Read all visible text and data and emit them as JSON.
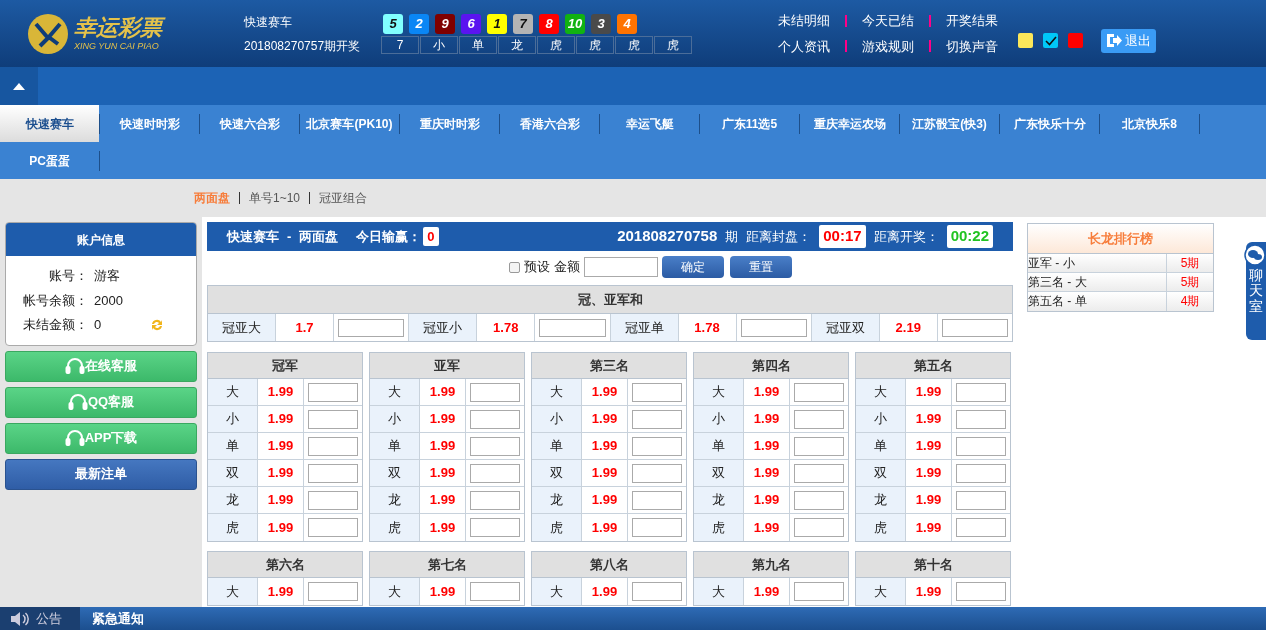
{
  "header": {
    "logo_title": "幸运彩票",
    "logo_subtitle": "XING YUN CAI PIAO",
    "game": "快速赛车",
    "draw_label": "201808270757期开奖",
    "balls": [
      {
        "number": "5",
        "color": "#81ffff"
      },
      {
        "number": "2",
        "color": "#0a86f5"
      },
      {
        "number": "9",
        "color": "#7f0000"
      },
      {
        "number": "6",
        "color": "#5a14f0"
      },
      {
        "number": "1",
        "color": "#ffff00"
      },
      {
        "number": "7",
        "color": "#b4b4b4"
      },
      {
        "number": "8",
        "color": "#ff0000"
      },
      {
        "number": "10",
        "color": "#11b211"
      },
      {
        "number": "3",
        "color": "#4a4a4a"
      },
      {
        "number": "4",
        "color": "#ff7300"
      }
    ],
    "results": [
      "7",
      "小",
      "单",
      "龙",
      "虎",
      "虎",
      "虎",
      "虎"
    ],
    "links": [
      "未结明细",
      "今天已结",
      "开奖结果",
      "个人资讯",
      "游戏规则",
      "切换声音"
    ],
    "swatches": [
      {
        "color": "#fbe75a",
        "selected": false
      },
      {
        "color": "#00c8f8",
        "selected": true
      },
      {
        "color": "#ff0000",
        "selected": false
      }
    ],
    "logout": "退出"
  },
  "nav": [
    {
      "label": "快速赛车",
      "selected": true
    },
    {
      "label": "快速时时彩",
      "selected": false
    },
    {
      "label": "快速六合彩",
      "selected": false
    },
    {
      "label": "北京赛车(PK10)",
      "selected": false
    },
    {
      "label": "重庆时时彩",
      "selected": false
    },
    {
      "label": "香港六合彩",
      "selected": false
    },
    {
      "label": "幸运飞艇",
      "selected": false
    },
    {
      "label": "广东11选5",
      "selected": false
    },
    {
      "label": "重庆幸运农场",
      "selected": false
    },
    {
      "label": "江苏骰宝(快3)",
      "selected": false
    },
    {
      "label": "广东快乐十分",
      "selected": false
    },
    {
      "label": "北京快乐8",
      "selected": false
    },
    {
      "label": "PC蛋蛋",
      "selected": false
    }
  ],
  "subnav": [
    {
      "label": "两面盘",
      "selected": true
    },
    {
      "label": "单号1~10",
      "selected": false
    },
    {
      "label": "冠亚组合",
      "selected": false
    }
  ],
  "account": {
    "title": "账户信息",
    "rows": [
      {
        "label": "账号：",
        "value": "游客"
      },
      {
        "label": "帐号余额：",
        "value": "2000"
      },
      {
        "label": "未结金额：",
        "value": "0"
      }
    ]
  },
  "side_buttons": [
    {
      "label": "在线客服",
      "kind": "support"
    },
    {
      "label": "QQ客服",
      "kind": "support"
    },
    {
      "label": "APP下载",
      "kind": "support"
    },
    {
      "label": "最新注单",
      "kind": "plain"
    }
  ],
  "bet_header": {
    "game": "快速赛车",
    "separator": "-",
    "mode": "两面盘",
    "pl_label": "今日输赢：",
    "pl_value": "0",
    "period": "201808270758",
    "period_unit": "期",
    "close_label": "距离封盘：",
    "close_time": "00:17",
    "draw_label": "距离开奖：",
    "draw_time": "00:22"
  },
  "preset": {
    "label": "预设",
    "checked": false,
    "amount_label": "金额",
    "confirm": "确定",
    "reset": "重置"
  },
  "sum_group": {
    "title": "冠、亚军和",
    "cells": [
      {
        "name": "冠亚大",
        "odds": "1.7"
      },
      {
        "name": "冠亚小",
        "odds": "1.78"
      },
      {
        "name": "冠亚单",
        "odds": "1.78"
      },
      {
        "name": "冠亚双",
        "odds": "2.19"
      }
    ]
  },
  "groups": [
    {
      "title": "冠军",
      "rows": [
        {
          "name": "大",
          "odds": "1.99"
        },
        {
          "name": "小",
          "odds": "1.99"
        },
        {
          "name": "单",
          "odds": "1.99"
        },
        {
          "name": "双",
          "odds": "1.99"
        },
        {
          "name": "龙",
          "odds": "1.99"
        },
        {
          "name": "虎",
          "odds": "1.99"
        }
      ]
    },
    {
      "title": "亚军",
      "rows": [
        {
          "name": "大",
          "odds": "1.99"
        },
        {
          "name": "小",
          "odds": "1.99"
        },
        {
          "name": "单",
          "odds": "1.99"
        },
        {
          "name": "双",
          "odds": "1.99"
        },
        {
          "name": "龙",
          "odds": "1.99"
        },
        {
          "name": "虎",
          "odds": "1.99"
        }
      ]
    },
    {
      "title": "第三名",
      "rows": [
        {
          "name": "大",
          "odds": "1.99"
        },
        {
          "name": "小",
          "odds": "1.99"
        },
        {
          "name": "单",
          "odds": "1.99"
        },
        {
          "name": "双",
          "odds": "1.99"
        },
        {
          "name": "龙",
          "odds": "1.99"
        },
        {
          "name": "虎",
          "odds": "1.99"
        }
      ]
    },
    {
      "title": "第四名",
      "rows": [
        {
          "name": "大",
          "odds": "1.99"
        },
        {
          "name": "小",
          "odds": "1.99"
        },
        {
          "name": "单",
          "odds": "1.99"
        },
        {
          "name": "双",
          "odds": "1.99"
        },
        {
          "name": "龙",
          "odds": "1.99"
        },
        {
          "name": "虎",
          "odds": "1.99"
        }
      ]
    },
    {
      "title": "第五名",
      "rows": [
        {
          "name": "大",
          "odds": "1.99"
        },
        {
          "name": "小",
          "odds": "1.99"
        },
        {
          "name": "单",
          "odds": "1.99"
        },
        {
          "name": "双",
          "odds": "1.99"
        },
        {
          "name": "龙",
          "odds": "1.99"
        },
        {
          "name": "虎",
          "odds": "1.99"
        }
      ]
    },
    {
      "title": "第六名",
      "rows": [
        {
          "name": "大",
          "odds": "1.99"
        }
      ]
    },
    {
      "title": "第七名",
      "rows": [
        {
          "name": "大",
          "odds": "1.99"
        }
      ]
    },
    {
      "title": "第八名",
      "rows": [
        {
          "name": "大",
          "odds": "1.99"
        }
      ]
    },
    {
      "title": "第九名",
      "rows": [
        {
          "name": "大",
          "odds": "1.99"
        }
      ]
    },
    {
      "title": "第十名",
      "rows": [
        {
          "name": "大",
          "odds": "1.99"
        }
      ]
    }
  ],
  "ranking": {
    "title": "长龙排行榜",
    "rows": [
      {
        "name": "亚军 - 小",
        "count": "5期"
      },
      {
        "name": "第三名 - 大",
        "count": "5期"
      },
      {
        "name": "第五名 - 单",
        "count": "4期"
      }
    ]
  },
  "chat": {
    "label": "聊天室"
  },
  "footer": {
    "notice_label": "公告",
    "message": "紧急通知"
  }
}
